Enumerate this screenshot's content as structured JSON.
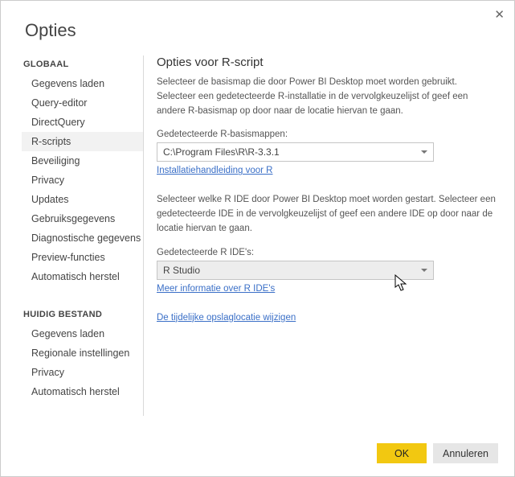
{
  "window": {
    "title": "Opties"
  },
  "sidebar": {
    "section_global": "GLOBAAL",
    "section_file": "HUIDIG BESTAND",
    "global_items": [
      {
        "label": "Gegevens laden"
      },
      {
        "label": "Query-editor"
      },
      {
        "label": "DirectQuery"
      },
      {
        "label": "R-scripts",
        "selected": true
      },
      {
        "label": "Beveiliging"
      },
      {
        "label": "Privacy"
      },
      {
        "label": "Updates"
      },
      {
        "label": "Gebruiksgegevens"
      },
      {
        "label": "Diagnostische gegevens"
      },
      {
        "label": "Preview-functies"
      },
      {
        "label": "Automatisch herstel"
      }
    ],
    "file_items": [
      {
        "label": "Gegevens laden"
      },
      {
        "label": "Regionale instellingen"
      },
      {
        "label": "Privacy"
      },
      {
        "label": "Automatisch herstel"
      }
    ]
  },
  "content": {
    "heading": "Opties voor R-script",
    "intro": "Selecteer de basismap die door Power BI Desktop moet worden gebruikt. Selecteer een gedetecteerde R-installatie in de vervolgkeuzelijst of geef een andere R-basismap op door naar de locatie hiervan te gaan.",
    "detected_dirs_label": "Gedetecteerde R-basismappen:",
    "detected_dirs_value": "C:\\Program Files\\R\\R-3.3.1",
    "install_guide_link": "Installatiehandleiding voor R",
    "ide_intro": "Selecteer welke R IDE door Power BI Desktop moet worden gestart. Selecteer een gedetecteerde IDE in de vervolgkeuzelijst of geef een andere IDE op door naar de locatie hiervan te gaan.",
    "detected_ides_label": "Gedetecteerde R IDE's:",
    "detected_ides_value": "R Studio",
    "ide_info_link": "Meer informatie over R IDE's",
    "temp_storage_link": "De tijdelijke opslaglocatie wijzigen"
  },
  "footer": {
    "ok": "OK",
    "cancel": "Annuleren"
  }
}
